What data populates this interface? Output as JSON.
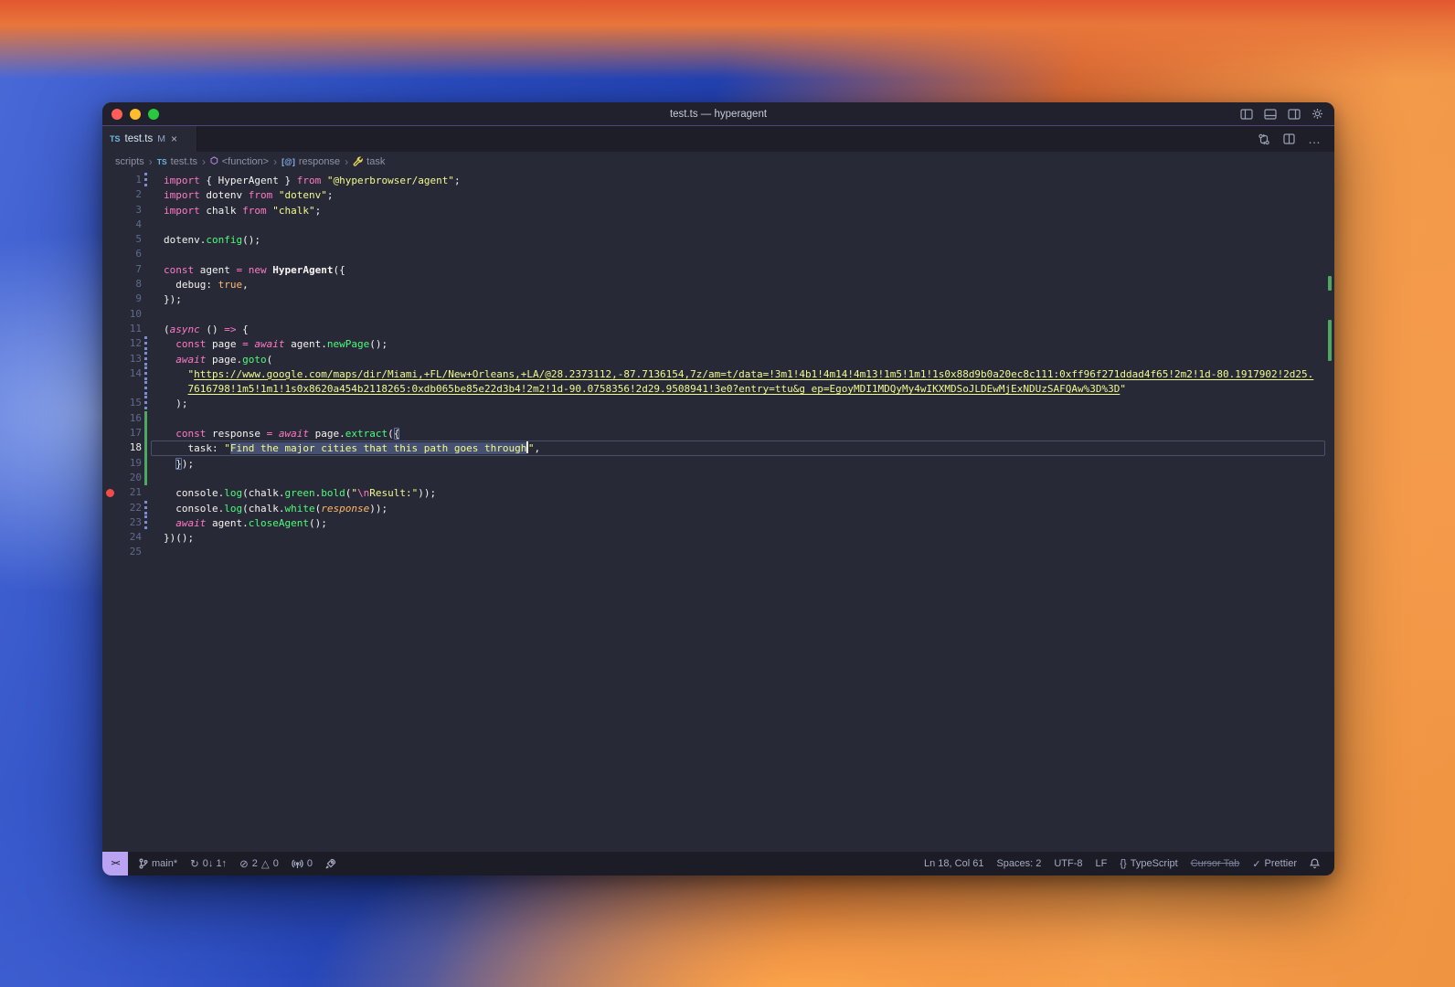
{
  "window": {
    "title": "test.ts — hyperagent"
  },
  "colors": {
    "editor_bg": "#272936",
    "accent_purple": "#bd93f9",
    "keyword": "#ff79c6",
    "string": "#f1fa8c",
    "function": "#50fa7b",
    "git_added": "#4fa85f",
    "git_modified": "#7b8cd4",
    "breakpoint": "#f14c4c",
    "remote_badge": "#b9a3f2"
  },
  "icons": {
    "close": "×",
    "chevron": "›",
    "ellipsis": "…",
    "check": "✓",
    "braces": "{}",
    "sync": "↻",
    "error": "⊘",
    "warning": "△",
    "remote": "><",
    "ns": "⬡",
    "var": "[@]",
    "ts": "TS"
  },
  "tab": {
    "file_type": "TS",
    "name": "test.ts",
    "git_status": "M"
  },
  "breadcrumbs": {
    "items": [
      {
        "label": "scripts"
      },
      {
        "label": "test.ts"
      },
      {
        "label": "<function>"
      },
      {
        "label": "response"
      },
      {
        "label": "task"
      }
    ]
  },
  "editor": {
    "lines": [
      {
        "n": "1",
        "d": "mod",
        "toks": [
          [
            "kw",
            "import"
          ],
          [
            "p",
            " { "
          ],
          [
            "v",
            "HyperAgent"
          ],
          [
            "p",
            " } "
          ],
          [
            "kw",
            "from"
          ],
          [
            "p",
            " "
          ],
          [
            "s",
            "\"@hyperbrowser/agent\""
          ],
          [
            "p",
            ";"
          ]
        ]
      },
      {
        "n": "2",
        "toks": [
          [
            "kw",
            "import"
          ],
          [
            "p",
            " "
          ],
          [
            "v",
            "dotenv"
          ],
          [
            "p",
            " "
          ],
          [
            "kw",
            "from"
          ],
          [
            "p",
            " "
          ],
          [
            "s",
            "\"dotenv\""
          ],
          [
            "p",
            ";"
          ]
        ]
      },
      {
        "n": "3",
        "toks": [
          [
            "kw",
            "import"
          ],
          [
            "p",
            " "
          ],
          [
            "v",
            "chalk"
          ],
          [
            "p",
            " "
          ],
          [
            "kw",
            "from"
          ],
          [
            "p",
            " "
          ],
          [
            "s",
            "\"chalk\""
          ],
          [
            "p",
            ";"
          ]
        ]
      },
      {
        "n": "4",
        "toks": []
      },
      {
        "n": "5",
        "toks": [
          [
            "v",
            "dotenv"
          ],
          [
            "p",
            "."
          ],
          [
            "fn",
            "config"
          ],
          [
            "p",
            "();"
          ]
        ]
      },
      {
        "n": "6",
        "toks": []
      },
      {
        "n": "7",
        "toks": [
          [
            "kw",
            "const"
          ],
          [
            "p",
            " "
          ],
          [
            "v",
            "agent"
          ],
          [
            "p",
            " "
          ],
          [
            "op",
            "="
          ],
          [
            "p",
            " "
          ],
          [
            "kw",
            "new"
          ],
          [
            "p",
            " "
          ],
          [
            "cls",
            "HyperAgent"
          ],
          [
            "p",
            "({"
          ]
        ]
      },
      {
        "n": "8",
        "toks": [
          [
            "p",
            "  "
          ],
          [
            "v",
            "debug"
          ],
          [
            "p",
            ": "
          ],
          [
            "num",
            "true"
          ],
          [
            "p",
            ","
          ]
        ]
      },
      {
        "n": "9",
        "toks": [
          [
            "p",
            "});"
          ]
        ]
      },
      {
        "n": "10",
        "toks": []
      },
      {
        "n": "11",
        "toks": [
          [
            "p",
            "("
          ],
          [
            "kwi",
            "async"
          ],
          [
            "p",
            " () "
          ],
          [
            "op",
            "=>"
          ],
          [
            "p",
            " {"
          ]
        ]
      },
      {
        "n": "12",
        "d": "mod",
        "toks": [
          [
            "p",
            "  "
          ],
          [
            "kw",
            "const"
          ],
          [
            "p",
            " "
          ],
          [
            "v",
            "page"
          ],
          [
            "p",
            " "
          ],
          [
            "op",
            "="
          ],
          [
            "p",
            " "
          ],
          [
            "kwi",
            "await"
          ],
          [
            "p",
            " "
          ],
          [
            "v",
            "agent"
          ],
          [
            "p",
            "."
          ],
          [
            "fn",
            "newPage"
          ],
          [
            "p",
            "();"
          ]
        ]
      },
      {
        "n": "13",
        "d": "mod",
        "toks": [
          [
            "p",
            "  "
          ],
          [
            "kwi",
            "await"
          ],
          [
            "p",
            " "
          ],
          [
            "v",
            "page"
          ],
          [
            "p",
            "."
          ],
          [
            "fn",
            "goto"
          ],
          [
            "p",
            "("
          ]
        ]
      },
      {
        "n": "14",
        "d": "mod",
        "toks": [
          [
            "p",
            "    "
          ],
          [
            "s",
            "\""
          ],
          [
            "link",
            "https://www.google.com/maps/dir/Miami,+FL/New+Orleans,+LA/@28.2373112,-87.7136154,7z/am=t/data=!3m1!4b1!4m14!4m13!1m5!1m1!1s0x88d9b0a20ec8c111:0xff96f271ddad4f65!2m2!1d-80.1917902!2d25."
          ]
        ]
      },
      {
        "n": "",
        "d": "mod",
        "toks": [
          [
            "p",
            "    "
          ],
          [
            "link",
            "7616798!1m5!1m1!1s0x8620a454b2118265:0xdb065be85e22d3b4!2m2!1d-90.0758356!2d29.9508941!3e0?entry=ttu&g_ep=EgoyMDI1MDQyMy4wIKXMDSoJLDEwMjExNDUzSAFQAw%3D%3D"
          ],
          [
            "s",
            "\""
          ]
        ]
      },
      {
        "n": "15",
        "d": "mod",
        "toks": [
          [
            "p",
            "  );"
          ]
        ]
      },
      {
        "n": "16",
        "d": "add",
        "toks": []
      },
      {
        "n": "17",
        "d": "add",
        "toks": [
          [
            "p",
            "  "
          ],
          [
            "kw",
            "const"
          ],
          [
            "p",
            " "
          ],
          [
            "v",
            "response"
          ],
          [
            "p",
            " "
          ],
          [
            "op",
            "="
          ],
          [
            "p",
            " "
          ],
          [
            "kwi",
            "await"
          ],
          [
            "p",
            " "
          ],
          [
            "v",
            "page"
          ],
          [
            "p",
            "."
          ],
          [
            "fn",
            "extract"
          ],
          [
            "p",
            "("
          ],
          [
            "bm",
            "{"
          ]
        ]
      },
      {
        "n": "18",
        "d": "add",
        "cur": true,
        "toks": [
          [
            "p",
            "    "
          ],
          [
            "v",
            "task"
          ],
          [
            "p",
            ": "
          ],
          [
            "s",
            "\""
          ],
          [
            "ssel",
            "Find the major cities that this path goes through"
          ],
          [
            "caret",
            ""
          ],
          [
            "s",
            "\""
          ],
          [
            "p",
            ","
          ]
        ]
      },
      {
        "n": "19",
        "d": "add",
        "toks": [
          [
            "p",
            "  "
          ],
          [
            "bm",
            "}"
          ],
          [
            "p",
            ");"
          ]
        ]
      },
      {
        "n": "20",
        "d": "add",
        "toks": []
      },
      {
        "n": "21",
        "bp": true,
        "toks": [
          [
            "p",
            "  "
          ],
          [
            "v",
            "console"
          ],
          [
            "p",
            "."
          ],
          [
            "fn",
            "log"
          ],
          [
            "p",
            "("
          ],
          [
            "v",
            "chalk"
          ],
          [
            "p",
            "."
          ],
          [
            "fn",
            "green"
          ],
          [
            "p",
            "."
          ],
          [
            "fn",
            "bold"
          ],
          [
            "p",
            "("
          ],
          [
            "s",
            "\""
          ],
          [
            "esc",
            "\\n"
          ],
          [
            "s",
            "Result:\""
          ],
          [
            "p",
            "));"
          ]
        ]
      },
      {
        "n": "22",
        "d": "mod",
        "toks": [
          [
            "p",
            "  "
          ],
          [
            "v",
            "console"
          ],
          [
            "p",
            "."
          ],
          [
            "fn",
            "log"
          ],
          [
            "p",
            "("
          ],
          [
            "v",
            "chalk"
          ],
          [
            "p",
            "."
          ],
          [
            "fn",
            "white"
          ],
          [
            "p",
            "("
          ],
          [
            "prm",
            "response"
          ],
          [
            "p",
            "));"
          ]
        ]
      },
      {
        "n": "23",
        "d": "mod",
        "toks": [
          [
            "p",
            "  "
          ],
          [
            "kwi",
            "await"
          ],
          [
            "p",
            " "
          ],
          [
            "v",
            "agent"
          ],
          [
            "p",
            "."
          ],
          [
            "fn",
            "closeAgent"
          ],
          [
            "p",
            "();"
          ]
        ]
      },
      {
        "n": "24",
        "toks": [
          [
            "p",
            "})();"
          ]
        ]
      },
      {
        "n": "25",
        "toks": []
      }
    ]
  },
  "status_bar": {
    "branch": "main*",
    "sync": "0↓ 1↑",
    "errors": "2",
    "warnings": "0",
    "ports": "0",
    "position": "Ln 18, Col 61",
    "indentation": "Spaces: 2",
    "encoding": "UTF-8",
    "eol": "LF",
    "language": "TypeScript",
    "cursor_tab": "Cursor Tab",
    "prettier": "Prettier"
  }
}
